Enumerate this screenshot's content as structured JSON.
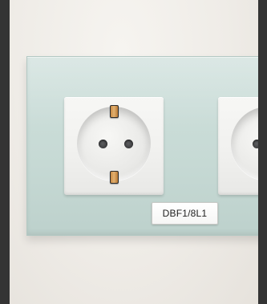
{
  "image": {
    "subject": "double-socket",
    "label_text": "DBF1/8L1",
    "colors": {
      "glass_plate": "#c7dad5",
      "socket_face": "#f1f1ef",
      "earth_clip": "#d19a52",
      "pin_hole": "#3e3f41",
      "background_wall": "#efece7",
      "frame": "#343434"
    },
    "icons": {
      "left_socket": "schuko-socket-icon",
      "right_socket": "schuko-socket-icon"
    }
  }
}
